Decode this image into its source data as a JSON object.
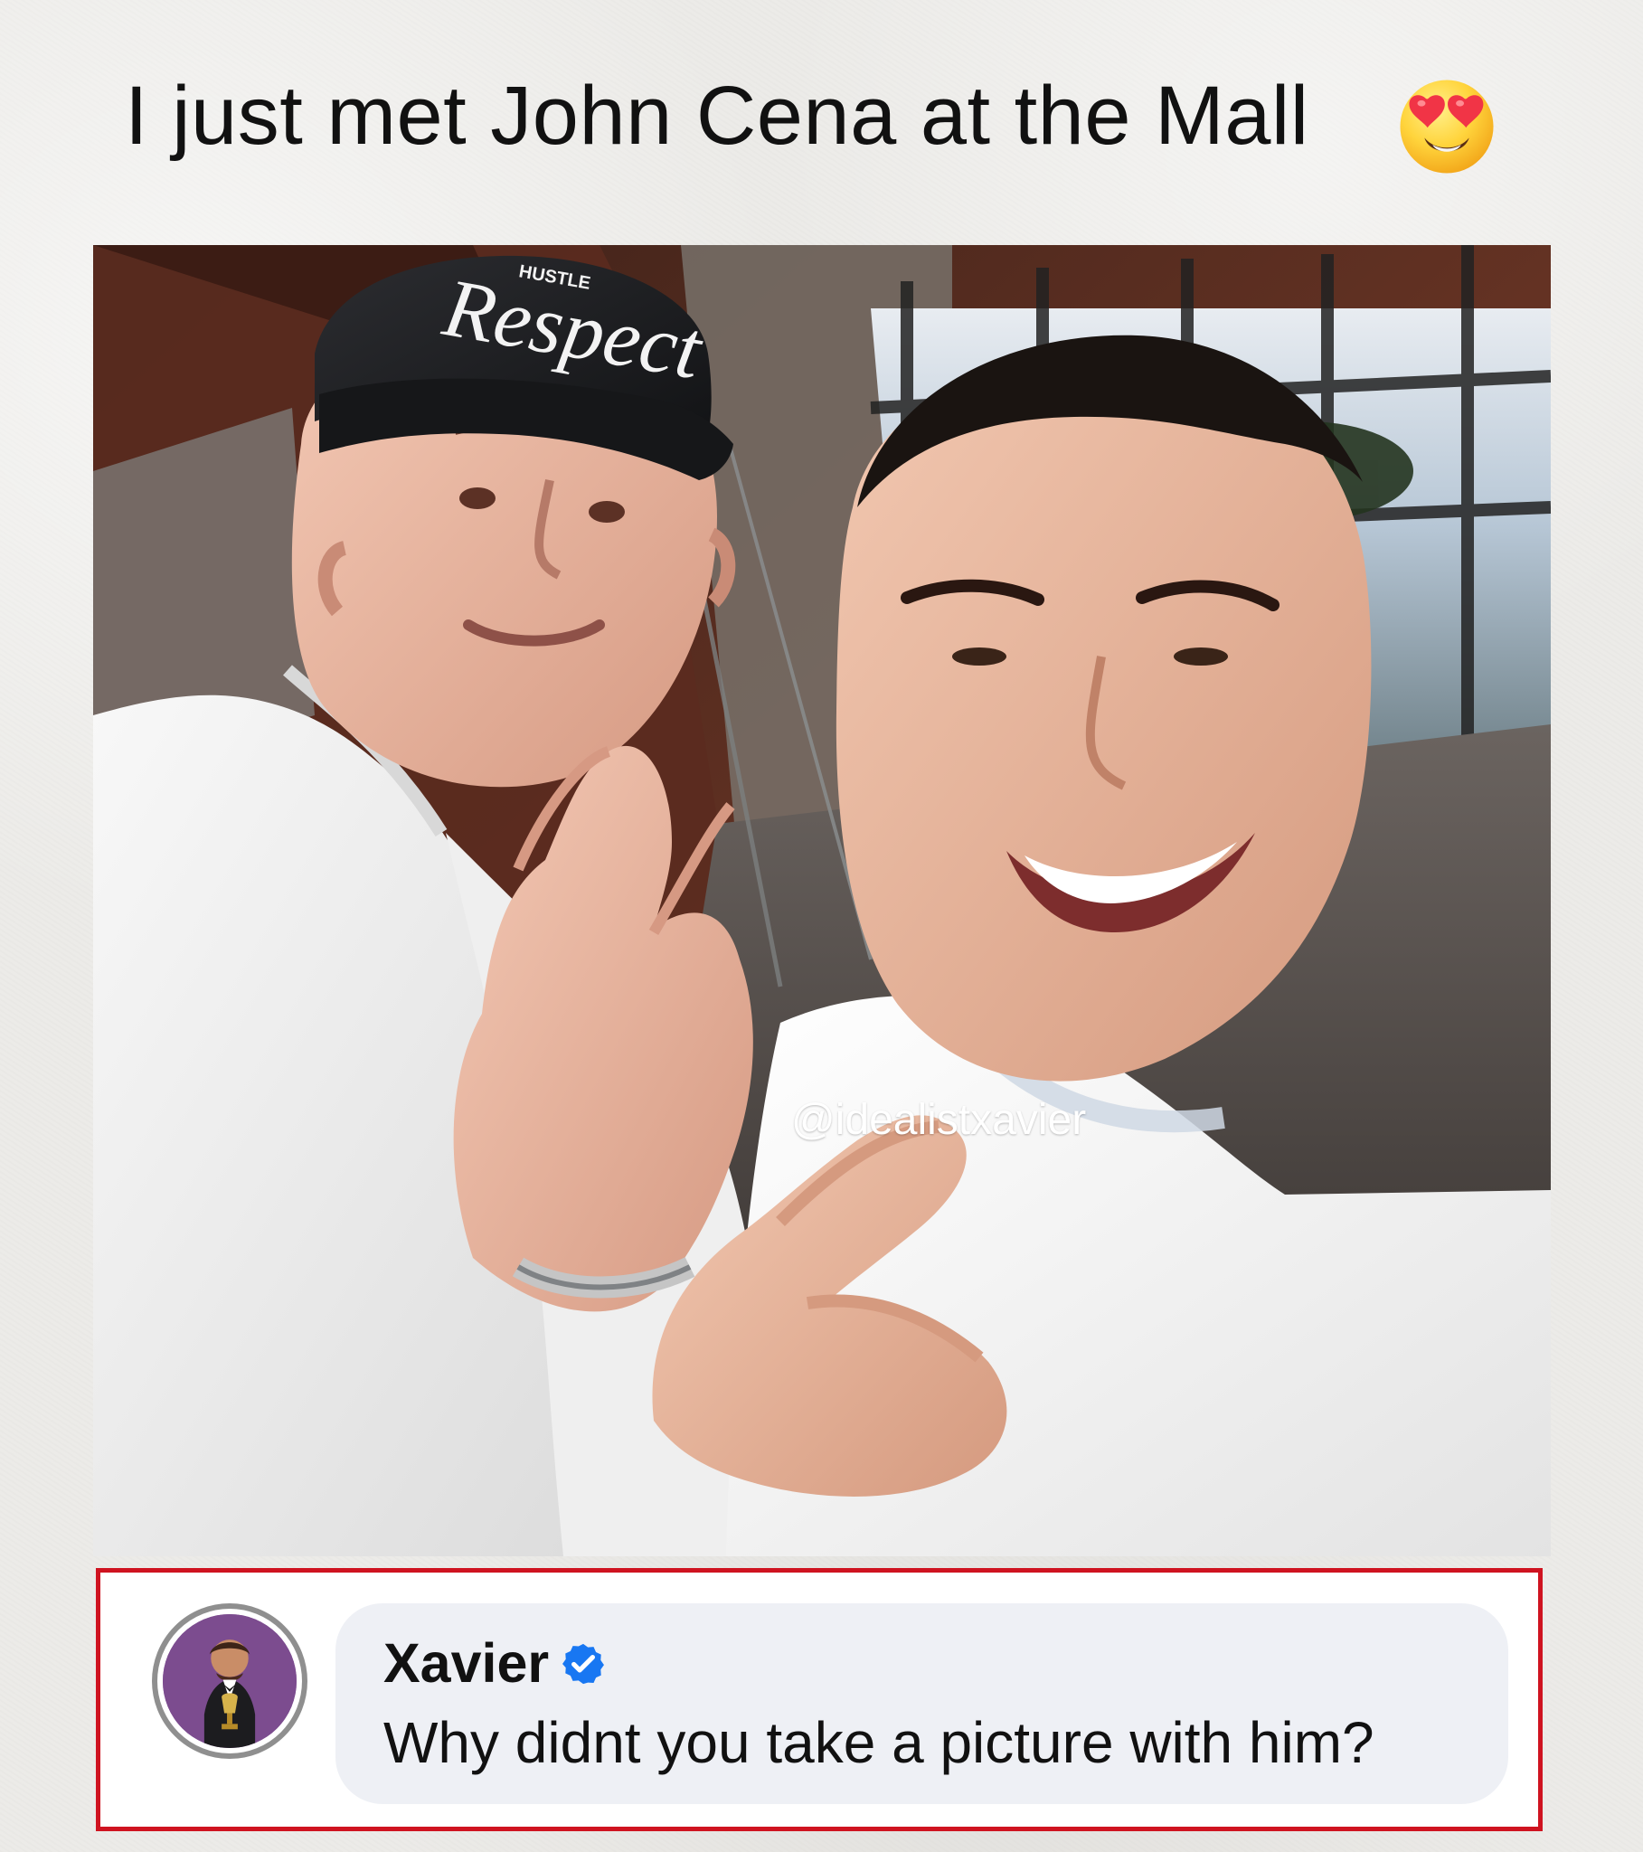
{
  "post": {
    "title": "I just met John Cena at the Mall",
    "emoji_name": "heart-eyes-emoji"
  },
  "photo": {
    "watermark": "@idealistxavier",
    "cap_text": "Respect",
    "cap_brand": "HUSTLE"
  },
  "comment": {
    "author": "Xavier",
    "verified": true,
    "text": "Why didnt you take a picture with him?",
    "avatar_icon": "tuxedo-trophy-avatar",
    "verified_icon": "verified-badge-icon"
  },
  "colors": {
    "highlight_border": "#cf1320",
    "verified_blue": "#1877f2",
    "bubble_bg": "#eef0f5",
    "avatar_bg": "#7c4c8f"
  }
}
